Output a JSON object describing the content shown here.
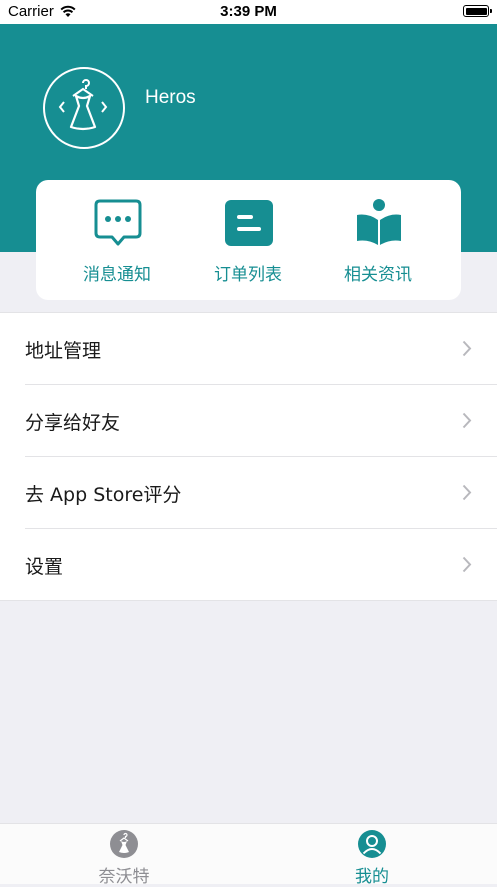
{
  "status_bar": {
    "carrier": "Carrier",
    "time": "3:39 PM"
  },
  "profile": {
    "username": "Heros",
    "avatar_icon": "dress-hanger-icon"
  },
  "colors": {
    "brand": "#168e92",
    "background": "#efeff4",
    "inactive_tab": "#8e8e93"
  },
  "quick_actions": [
    {
      "label": "消息通知",
      "icon": "message-icon"
    },
    {
      "label": "订单列表",
      "icon": "order-list-icon"
    },
    {
      "label": "相关资讯",
      "icon": "news-book-icon"
    }
  ],
  "menu": [
    {
      "label": "地址管理"
    },
    {
      "label": "分享给好友"
    },
    {
      "label": "去 App Store评分"
    },
    {
      "label": "设置"
    }
  ],
  "tabbar": [
    {
      "label": "奈沃特",
      "icon": "dress-tab-icon",
      "active": false
    },
    {
      "label": "我的",
      "icon": "user-profile-icon",
      "active": true
    }
  ]
}
